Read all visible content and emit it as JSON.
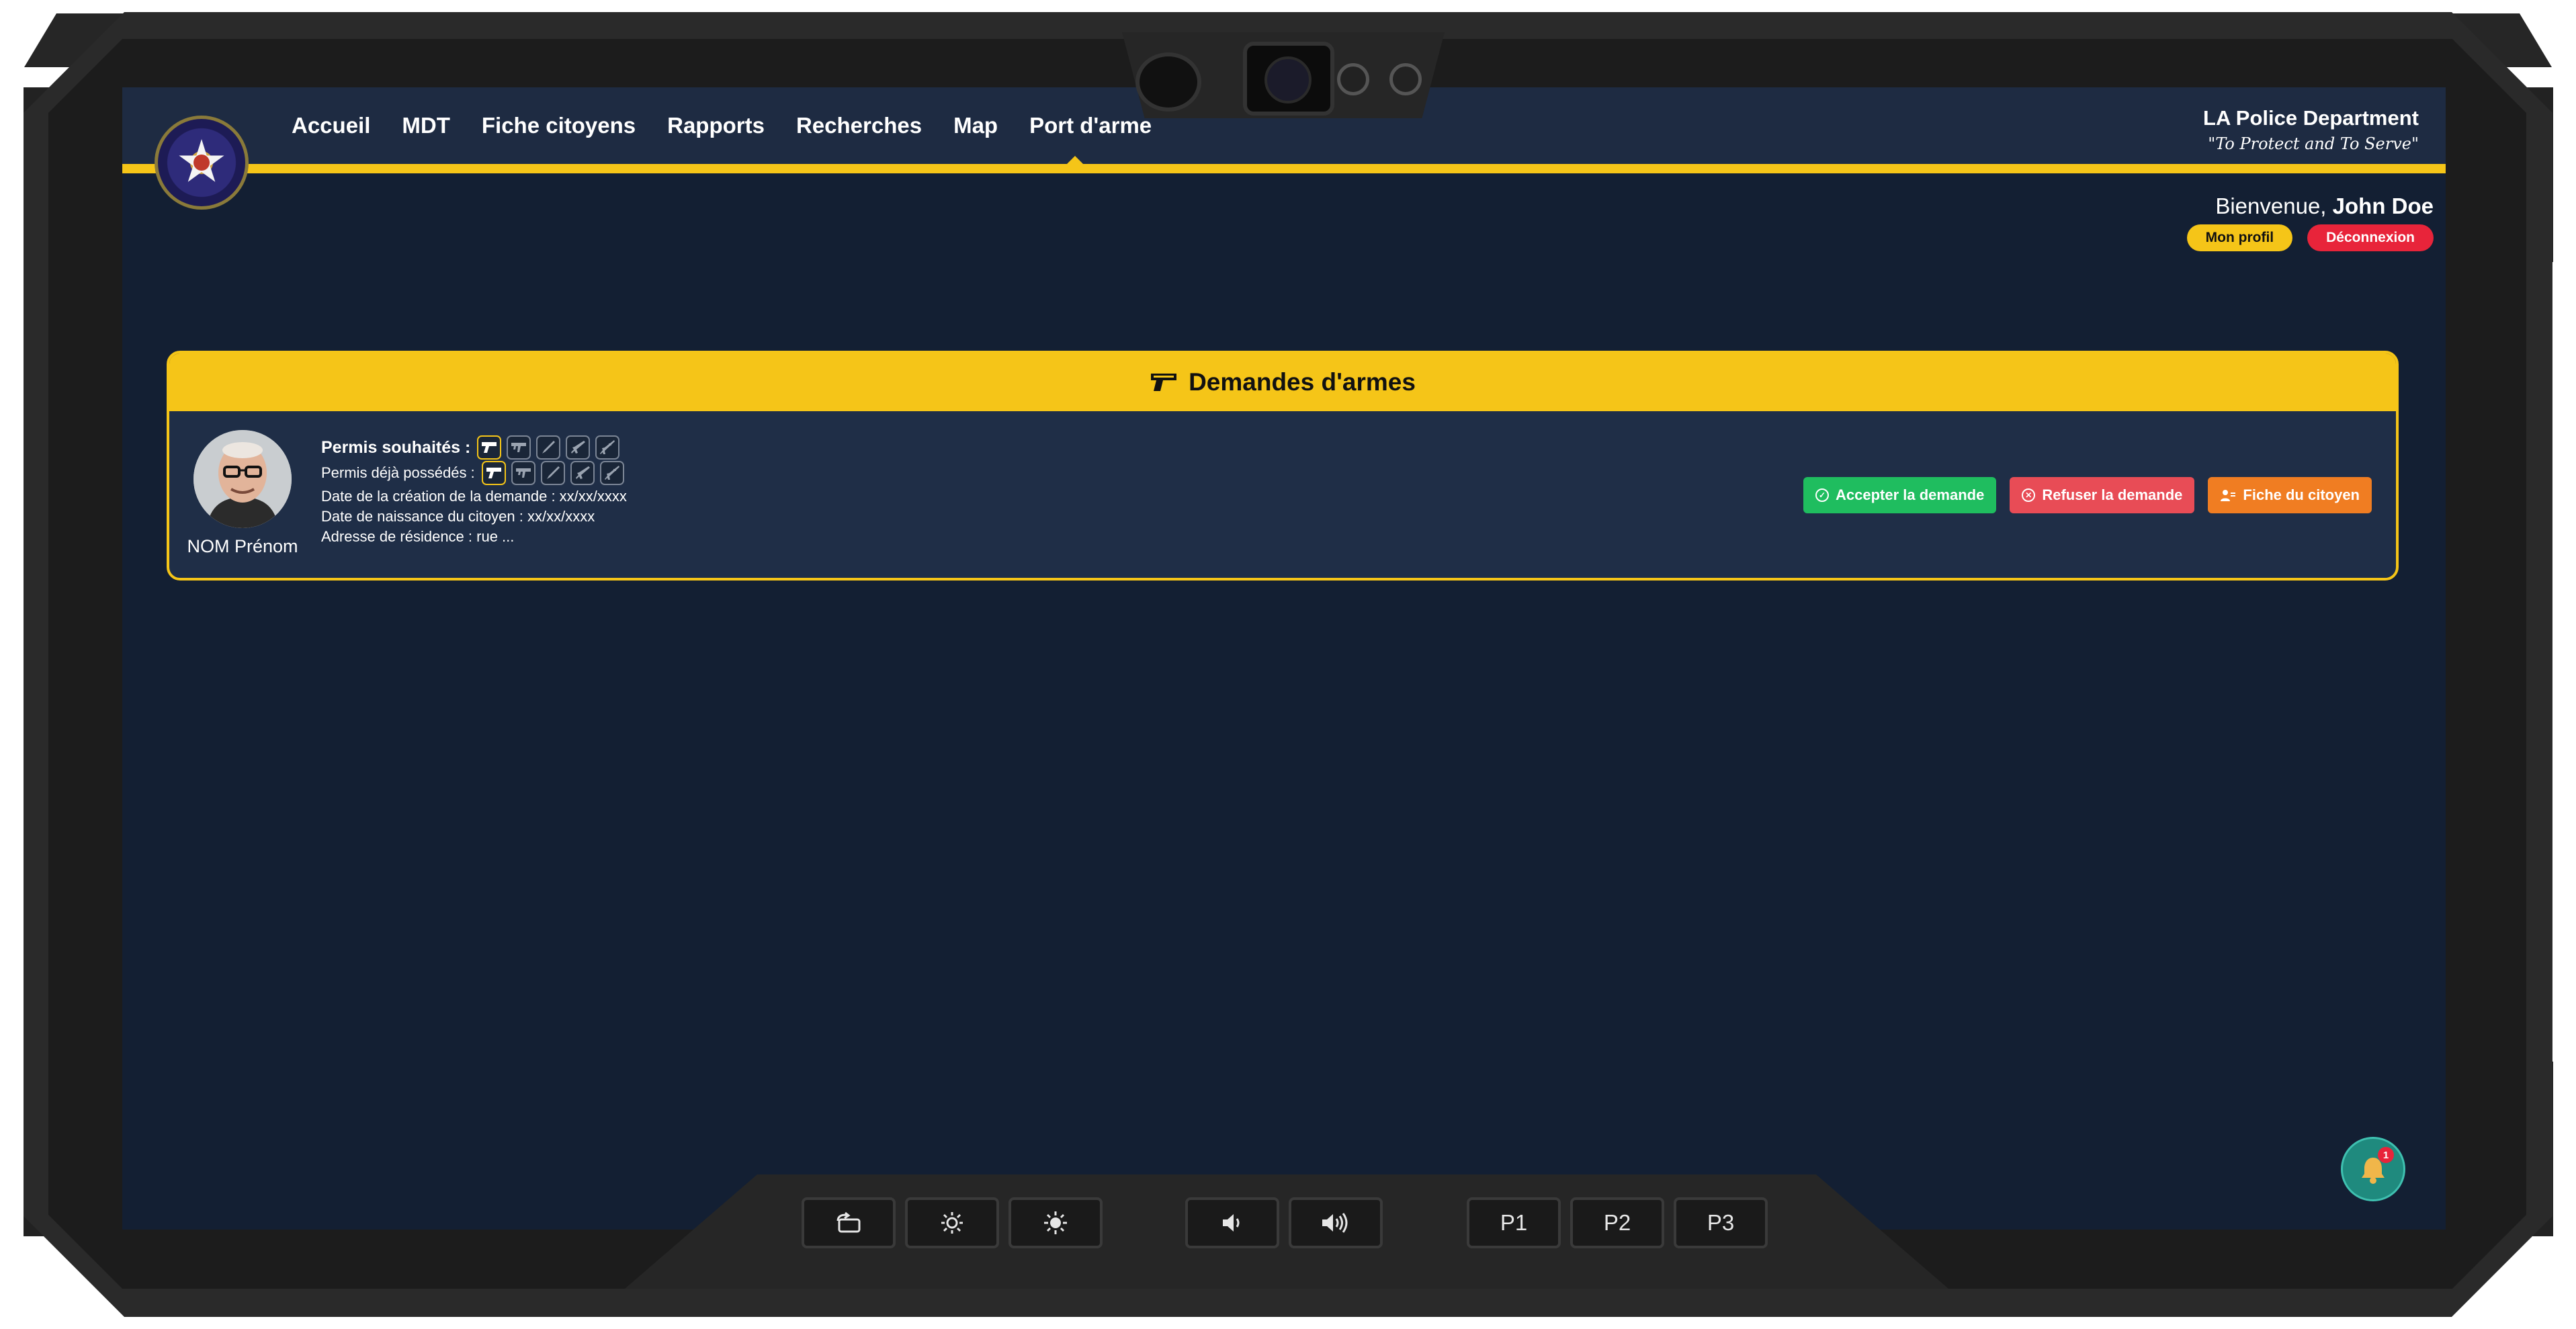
{
  "nav": {
    "items": [
      {
        "label": "Accueil"
      },
      {
        "label": "MDT"
      },
      {
        "label": "Fiche citoyens"
      },
      {
        "label": "Rapports"
      },
      {
        "label": "Recherches"
      },
      {
        "label": "Map"
      },
      {
        "label": "Port d'arme"
      }
    ],
    "active": "Port d'arme"
  },
  "brand": {
    "title": "LA Police Department",
    "motto": "\"To Protect and To Serve\""
  },
  "user": {
    "greeting": "Bienvenue,",
    "name": "John Doe",
    "profile_button": "Mon profil",
    "logout_button": "Déconnexion"
  },
  "panel": {
    "title": "Demandes d'armes",
    "icon": "gun-icon"
  },
  "request": {
    "citizen_name": "NOM Prénom",
    "wanted_label": "Permis souhaités :",
    "owned_label": "Permis déjà possédés :",
    "creation_date": "Date de la création de la demande : xx/xx/xxxx",
    "birth_date": "Date de naissance du citoyen : xx/xx/xxxx",
    "address": "Adresse de résidence : rue ...",
    "wanted_permits": [
      "pistol-icon",
      "smg-icon",
      "melee-icon",
      "rifle-icon",
      "sniper-icon"
    ],
    "owned_permits": [
      "pistol-icon",
      "smg-icon",
      "melee-icon",
      "rifle-icon",
      "sniper-icon"
    ]
  },
  "actions": {
    "accept": "Accepter la demande",
    "refuse": "Refuser la demande",
    "citizen_sheet": "Fiche du citoyen"
  },
  "notifications": {
    "count": "1"
  },
  "hardware": {
    "presets": [
      "P1",
      "P2",
      "P3"
    ]
  },
  "colors": {
    "accent": "#f5c518",
    "background": "#131f33",
    "header": "#1e2b42",
    "accept": "#1fbd5f",
    "refuse": "#e84c56",
    "sheet": "#f07d22",
    "logout": "#e8243a"
  }
}
